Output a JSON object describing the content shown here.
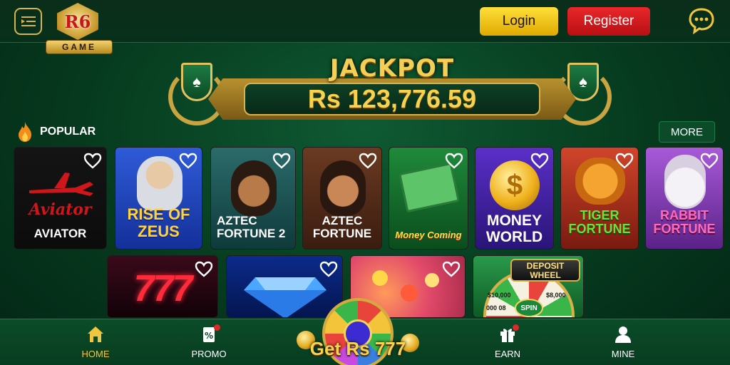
{
  "header": {
    "logo_text": "R6",
    "logo_subtext": "GAME",
    "login_label": "Login",
    "register_label": "Register"
  },
  "jackpot": {
    "title": "JACKPOT",
    "amount": "Rs 123,776.59"
  },
  "section": {
    "title": "POPULAR",
    "more_label": "MORE"
  },
  "games_row1": [
    {
      "name": "AVIATOR",
      "art_text": "Aviator"
    },
    {
      "name": "RISE OF ZEUS"
    },
    {
      "name": "AZTEC FORTUNE 2"
    },
    {
      "name": "AZTEC FORTUNE"
    },
    {
      "name": "Money Coming"
    },
    {
      "name": "MONEY WORLD"
    },
    {
      "name": "TIGER FORTUNE"
    },
    {
      "name": "RABBIT FORTUNE"
    }
  ],
  "games_row2": [
    {
      "name": "777"
    },
    {
      "name": ""
    },
    {
      "name": ""
    },
    {
      "name": "DEPOSIT WHEEL",
      "spin_label": "SPIN",
      "prize_values": [
        "$10,000",
        "$8,000",
        "000 08"
      ]
    }
  ],
  "bottom_nav": {
    "home": "HOME",
    "promo": "PROMO",
    "center_label": "Get Rs 777",
    "earn": "EARN",
    "mine": "MINE"
  },
  "colors": {
    "accent_gold": "#f2c63c",
    "login_yellow": "#ffd21c",
    "register_red": "#d81b1f",
    "background_green": "#063a1e"
  }
}
